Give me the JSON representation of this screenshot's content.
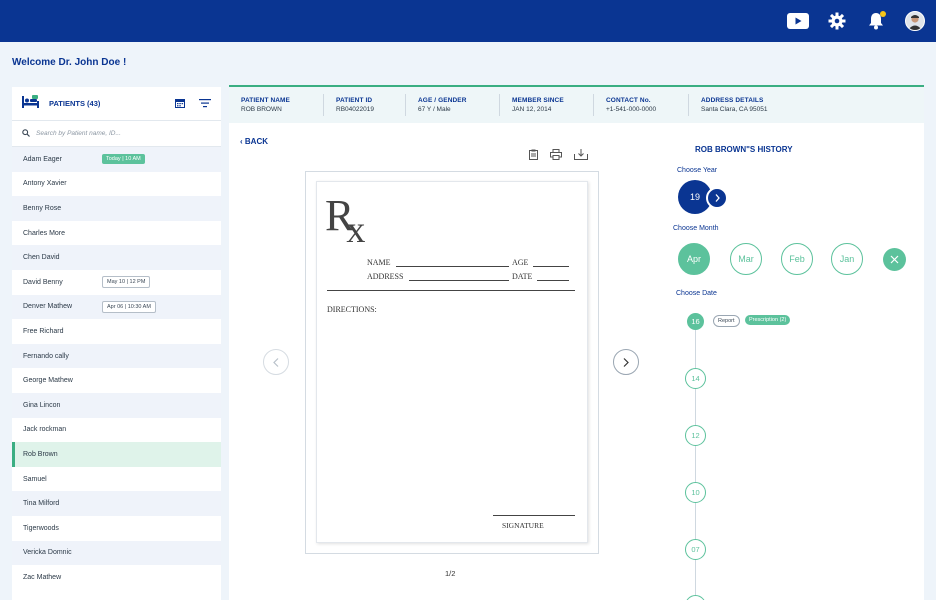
{
  "header": {
    "icons": [
      "youtube-icon",
      "gear-icon",
      "bell-icon",
      "avatar"
    ],
    "accent": "#0a3592",
    "notification_dot_color": "#f5c518"
  },
  "welcome": "Welcome Dr. John Doe !",
  "patients": {
    "title": "PATIENTS (43)",
    "search_placeholder": "Search by Patient name, ID...",
    "items": [
      {
        "name": "Adam Eager",
        "tag": "Today | 10 AM",
        "tag_style": "green"
      },
      {
        "name": "Antony Xavier"
      },
      {
        "name": "Benny Rose"
      },
      {
        "name": "Charles More"
      },
      {
        "name": "Chen David"
      },
      {
        "name": "David Benny",
        "tag": "May 10 | 12 PM",
        "tag_style": "outline"
      },
      {
        "name": "Denver Mathew",
        "tag": "Apr 06 | 10:30 AM",
        "tag_style": "outline"
      },
      {
        "name": "Free Richard"
      },
      {
        "name": "Fernando cally"
      },
      {
        "name": "George Mathew"
      },
      {
        "name": "Gina Lincon"
      },
      {
        "name": "Jack rockman"
      },
      {
        "name": "Rob Brown",
        "active": true
      },
      {
        "name": "Samuel"
      },
      {
        "name": "Tina Milford"
      },
      {
        "name": "Tigerwoods"
      },
      {
        "name": "Vericka Domnic"
      },
      {
        "name": "Zac Mathew"
      }
    ]
  },
  "patient_info": {
    "patient_name": {
      "label": "PATIENT NAME",
      "value": "ROB BROWN"
    },
    "patient_id": {
      "label": "PATIENT ID",
      "value": "RB04022019"
    },
    "age_gender": {
      "label": "AGE / GENDER",
      "value": "67 Y / Male"
    },
    "member_since": {
      "label": "MEMBER SINCE",
      "value": "JAN 12, 2014"
    },
    "contact": {
      "label": "CONTACT No.",
      "value": "+1-541-000-0000"
    },
    "address": {
      "label": "ADDRESS DETAILS",
      "value": "Santa Clara, CA 95051"
    }
  },
  "viewer": {
    "back_label": "BACK",
    "rx": {
      "name_label": "NAME",
      "age_label": "AGE",
      "address_label": "ADDRESS",
      "date_label": "DATE",
      "directions_label": "DIRECTIONS:",
      "signature_label": "SIGNATURE"
    },
    "page_indicator": "1/2"
  },
  "history": {
    "title": "ROB BROWN\"S HISTORY",
    "choose_year": "Choose Year",
    "year": "19",
    "choose_month": "Choose Month",
    "months": [
      "Apr",
      "Mar",
      "Feb",
      "Jan"
    ],
    "active_month": "Apr",
    "choose_date": "Choose Date",
    "dates": [
      "16",
      "14",
      "12",
      "10",
      "07"
    ],
    "active_date": "16",
    "chips": {
      "report": "Report",
      "prescription": "Prescription (2)"
    },
    "accent_green": "#5cc29c"
  }
}
